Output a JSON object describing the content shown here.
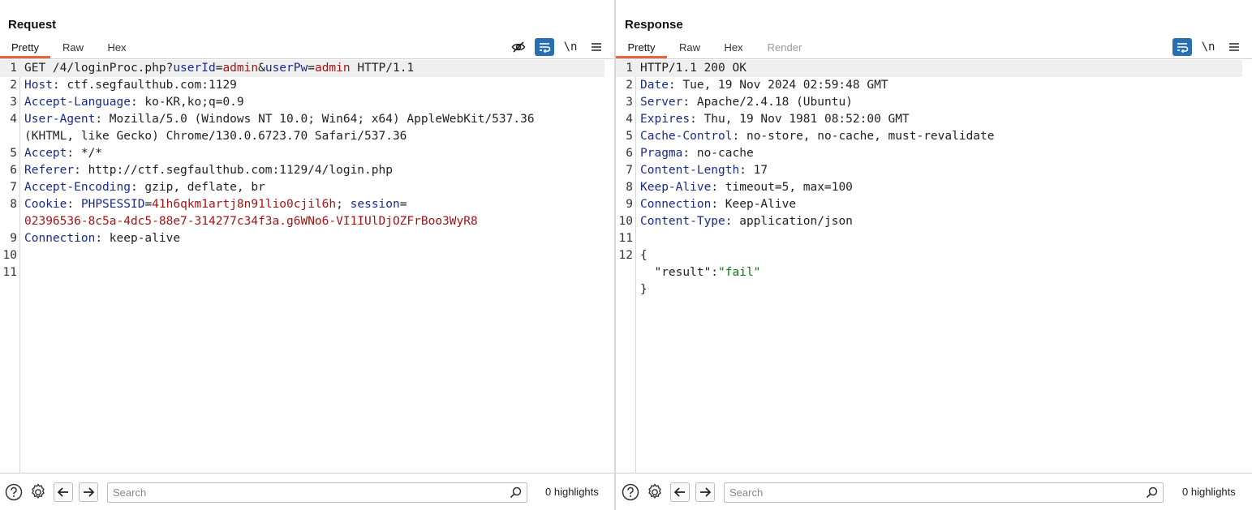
{
  "request": {
    "title": "Request",
    "tabs": [
      {
        "label": "Pretty",
        "active": true
      },
      {
        "label": "Raw",
        "active": false
      },
      {
        "label": "Hex",
        "active": false
      }
    ],
    "toolbar": {
      "newline_label": "\\n"
    },
    "lines": [
      {
        "num": "1",
        "segments": [
          {
            "t": "GET /4/loginProc.php?",
            "c": ""
          },
          {
            "t": "userId",
            "c": "pk"
          },
          {
            "t": "=",
            "c": ""
          },
          {
            "t": "admin",
            "c": "pv"
          },
          {
            "t": "&",
            "c": ""
          },
          {
            "t": "userPw",
            "c": "pk"
          },
          {
            "t": "=",
            "c": ""
          },
          {
            "t": "admin",
            "c": "pv"
          },
          {
            "t": " HTTP/1.1",
            "c": ""
          }
        ]
      },
      {
        "num": "2",
        "segments": [
          {
            "t": "Host",
            "c": "hn"
          },
          {
            "t": ": ctf.segfaulthub.com:1129",
            "c": ""
          }
        ]
      },
      {
        "num": "3",
        "segments": [
          {
            "t": "Accept-Language",
            "c": "hn"
          },
          {
            "t": ": ko-KR,ko;q=0.9",
            "c": ""
          }
        ]
      },
      {
        "num": "4",
        "segments": [
          {
            "t": "User-Agent",
            "c": "hn"
          },
          {
            "t": ": Mozilla/5.0 (Windows NT 10.0; Win64; x64) AppleWebKit/537.36",
            "c": ""
          }
        ]
      },
      {
        "num": "",
        "segments": [
          {
            "t": "(KHTML, like Gecko) Chrome/130.0.6723.70 Safari/537.36",
            "c": ""
          }
        ]
      },
      {
        "num": "5",
        "segments": [
          {
            "t": "Accept",
            "c": "hn"
          },
          {
            "t": ": */*",
            "c": ""
          }
        ]
      },
      {
        "num": "6",
        "segments": [
          {
            "t": "Referer",
            "c": "hn"
          },
          {
            "t": ": http://ctf.segfaulthub.com:1129/4/login.php",
            "c": ""
          }
        ]
      },
      {
        "num": "7",
        "segments": [
          {
            "t": "Accept-Encoding",
            "c": "hn"
          },
          {
            "t": ": gzip, deflate, br",
            "c": ""
          }
        ]
      },
      {
        "num": "8",
        "segments": [
          {
            "t": "Cookie",
            "c": "hn"
          },
          {
            "t": ": ",
            "c": ""
          },
          {
            "t": "PHPSESSID",
            "c": "ck"
          },
          {
            "t": "=",
            "c": ""
          },
          {
            "t": "41h6qkm1artj8n91lio0cjil6h",
            "c": "cv"
          },
          {
            "t": "; ",
            "c": ""
          },
          {
            "t": "session",
            "c": "ck"
          },
          {
            "t": "=",
            "c": ""
          }
        ]
      },
      {
        "num": "",
        "segments": [
          {
            "t": "02396536-8c5a-4dc5-88e7-314277c34f3a.g6WNo6-VI1IUlDjOZFrBoo3WyR8",
            "c": "cv"
          }
        ]
      },
      {
        "num": "9",
        "segments": [
          {
            "t": "Connection",
            "c": "hn"
          },
          {
            "t": ": keep-alive",
            "c": ""
          }
        ]
      },
      {
        "num": "10",
        "segments": []
      },
      {
        "num": "11",
        "segments": []
      }
    ],
    "search": {
      "placeholder": "Search",
      "value": ""
    },
    "highlights_label": "0 highlights"
  },
  "response": {
    "title": "Response",
    "tabs": [
      {
        "label": "Pretty",
        "active": true
      },
      {
        "label": "Raw",
        "active": false
      },
      {
        "label": "Hex",
        "active": false
      },
      {
        "label": "Render",
        "active": false,
        "disabled": true
      }
    ],
    "toolbar": {
      "newline_label": "\\n"
    },
    "lines": [
      {
        "num": "1",
        "segments": [
          {
            "t": "HTTP/1.1 200 OK",
            "c": ""
          }
        ]
      },
      {
        "num": "2",
        "segments": [
          {
            "t": "Date",
            "c": "hn"
          },
          {
            "t": ": Tue, 19 Nov 2024 02:59:48 GMT",
            "c": ""
          }
        ]
      },
      {
        "num": "3",
        "segments": [
          {
            "t": "Server",
            "c": "hn"
          },
          {
            "t": ": Apache/2.4.18 (Ubuntu)",
            "c": ""
          }
        ]
      },
      {
        "num": "4",
        "segments": [
          {
            "t": "Expires",
            "c": "hn"
          },
          {
            "t": ": Thu, 19 Nov 1981 08:52:00 GMT",
            "c": ""
          }
        ]
      },
      {
        "num": "5",
        "segments": [
          {
            "t": "Cache-Control",
            "c": "hn"
          },
          {
            "t": ": no-store, no-cache, must-revalidate",
            "c": ""
          }
        ]
      },
      {
        "num": "6",
        "segments": [
          {
            "t": "Pragma",
            "c": "hn"
          },
          {
            "t": ": no-cache",
            "c": ""
          }
        ]
      },
      {
        "num": "7",
        "segments": [
          {
            "t": "Content-Length",
            "c": "hn"
          },
          {
            "t": ": 17",
            "c": ""
          }
        ]
      },
      {
        "num": "8",
        "segments": [
          {
            "t": "Keep-Alive",
            "c": "hn"
          },
          {
            "t": ": timeout=5, max=100",
            "c": ""
          }
        ]
      },
      {
        "num": "9",
        "segments": [
          {
            "t": "Connection",
            "c": "hn"
          },
          {
            "t": ": Keep-Alive",
            "c": ""
          }
        ]
      },
      {
        "num": "10",
        "segments": [
          {
            "t": "Content-Type",
            "c": "hn"
          },
          {
            "t": ": application/json",
            "c": ""
          }
        ]
      },
      {
        "num": "11",
        "segments": []
      },
      {
        "num": "12",
        "segments": [
          {
            "t": "{",
            "c": "js"
          }
        ]
      },
      {
        "num": "",
        "segments": [
          {
            "t": "  \"result\":",
            "c": "js"
          },
          {
            "t": "\"fail\"",
            "c": "jstr"
          }
        ]
      },
      {
        "num": "",
        "segments": [
          {
            "t": "}",
            "c": "js"
          }
        ]
      }
    ],
    "search": {
      "placeholder": "Search",
      "value": ""
    },
    "highlights_label": "0 highlights"
  },
  "colors": {
    "accent_tab_underline": "#e8643c",
    "toolbar_active": "#2b6fb3",
    "header_name": "#1a2a8a",
    "param_value": "#a31515",
    "json_string": "#0c7a0c"
  },
  "icons": {
    "request_toolbar": [
      "eye-slash-icon",
      "word-wrap-icon",
      "newline-icon",
      "menu-icon"
    ],
    "response_toolbar": [
      "word-wrap-icon",
      "newline-icon",
      "menu-icon"
    ],
    "bottom": [
      "help-icon",
      "gear-icon",
      "arrow-left-icon",
      "arrow-right-icon",
      "search-icon"
    ],
    "layout": [
      "layout-side-by-side-icon",
      "layout-stacked-icon",
      "layout-single-icon"
    ]
  }
}
